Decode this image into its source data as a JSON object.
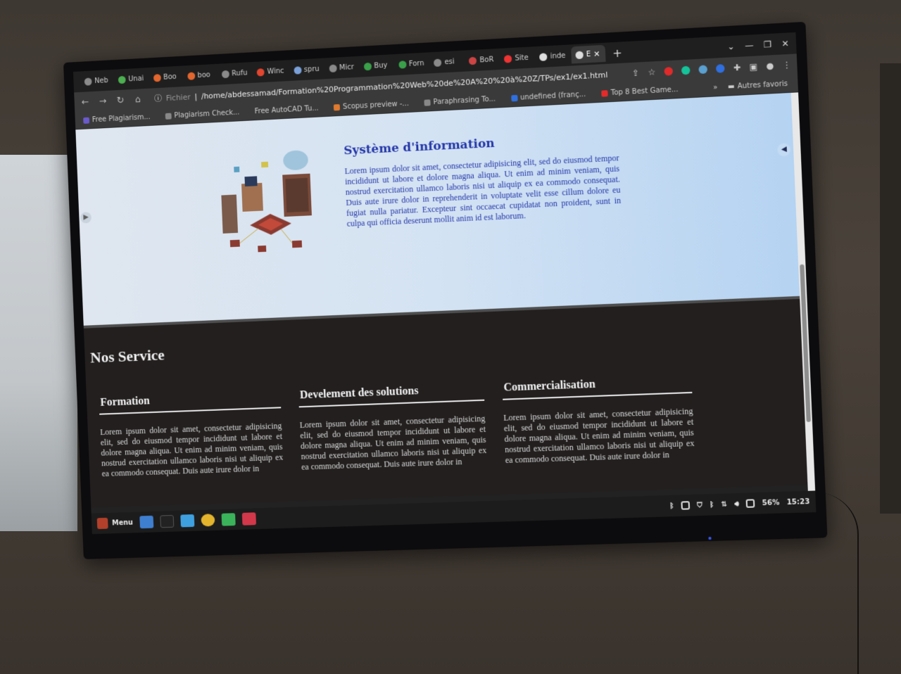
{
  "browser": {
    "tabs": [
      {
        "label": "Neb",
        "color": "#9c9c9c"
      },
      {
        "label": "Unai",
        "color": "#4caf50"
      },
      {
        "label": "Boo",
        "color": "#e2662e"
      },
      {
        "label": "boo",
        "color": "#e2662e"
      },
      {
        "label": "Rufu",
        "color": "#cccccc"
      },
      {
        "label": "Winc",
        "color": "#e2462e"
      },
      {
        "label": "spru",
        "color": "#7aa0d8"
      },
      {
        "label": "Micr",
        "color": "#cfcfcf"
      },
      {
        "label": "Buy",
        "color": "#3aa04a"
      },
      {
        "label": "Forn",
        "color": "#3aa04a"
      },
      {
        "label": "esi",
        "color": "#cccccc"
      },
      {
        "label": "BoR",
        "color": "#c44"
      },
      {
        "label": "Site",
        "color": "#e33"
      },
      {
        "label": "inde",
        "color": "#ddd"
      }
    ],
    "active_tab": {
      "label": "E"
    },
    "new_tab": "+",
    "window_controls": {
      "chevron": "⌄",
      "minimize": "—",
      "restore": "❐",
      "close": "✕"
    },
    "address": {
      "scheme": "Fichier",
      "url": "/home/abdessamad/Formation%20Programmation%20Web%20de%20A%20%20à%20Z/TPs/ex1/ex1.html"
    },
    "bookmarks": [
      {
        "label": "Free Plagiarism..."
      },
      {
        "label": "Plagiarism Check..."
      },
      {
        "label": "Free AutoCAD Tu..."
      },
      {
        "label": "Scopus preview -..."
      },
      {
        "label": "Paraphrasing To..."
      },
      {
        "label": "undefined (franç..."
      },
      {
        "label": "Top 8 Best Game..."
      }
    ],
    "bookmarks_more": "»",
    "other_bookmarks": "Autres favoris"
  },
  "page": {
    "hero": {
      "title": "Système d'information",
      "body": "Lorem ipsum dolor sit amet, consectetur adipisicing elit, sed do eiusmod tempor incididunt ut labore et dolore magna aliqua. Ut enim ad minim veniam, quis nostrud exercitation ullamco laboris nisi ut aliquip ex ea commodo consequat. Duis aute irure dolor in reprehenderit in voluptate velit esse cillum dolore eu fugiat nulla pariatur. Excepteur sint occaecat cupidatat non proident, sunt in culpa qui officia deserunt mollit anim id est laborum."
    },
    "services": {
      "title": "Nos Service",
      "cards": [
        {
          "title": "Formation",
          "body": "Lorem ipsum dolor sit amet, consectetur adipisicing elit, sed do eiusmod tempor incididunt ut labore et dolore magna aliqua. Ut enim ad minim veniam, quis nostrud exercitation ullamco laboris nisi ut aliquip ex ea commodo consequat. Duis aute irure dolor in"
        },
        {
          "title": "Develement des solutions",
          "body": "Lorem ipsum dolor sit amet, consectetur adipisicing elit, sed do eiusmod tempor incididunt ut labore et dolore magna aliqua. Ut enim ad minim veniam, quis nostrud exercitation ullamco laboris nisi ut aliquip ex ea commodo consequat. Duis aute irure dolor in"
        },
        {
          "title": "Commercialisation",
          "body": "Lorem ipsum dolor sit amet, consectetur adipisicing elit, sed do eiusmod tempor incididunt ut labore et dolore magna aliqua. Ut enim ad minim veniam, quis nostrud exercitation ullamco laboris nisi ut aliquip ex ea commodo consequat. Duis aute irure dolor in"
        }
      ]
    }
  },
  "taskbar": {
    "menu_label": "Menu",
    "apps": [
      {
        "name": "desktop",
        "color": "#3f7fd0"
      },
      {
        "name": "terminal",
        "color": "#222222"
      },
      {
        "name": "files",
        "color": "#3fa0e0"
      },
      {
        "name": "chrome",
        "color": "#e4b42d"
      },
      {
        "name": "store",
        "color": "#3ab35a"
      },
      {
        "name": "viewer",
        "color": "#d2384a"
      }
    ],
    "battery": "56%",
    "clock": "15:23"
  },
  "colors": {
    "hero_title": "#2335a8",
    "services_bg": "#231f1f"
  }
}
